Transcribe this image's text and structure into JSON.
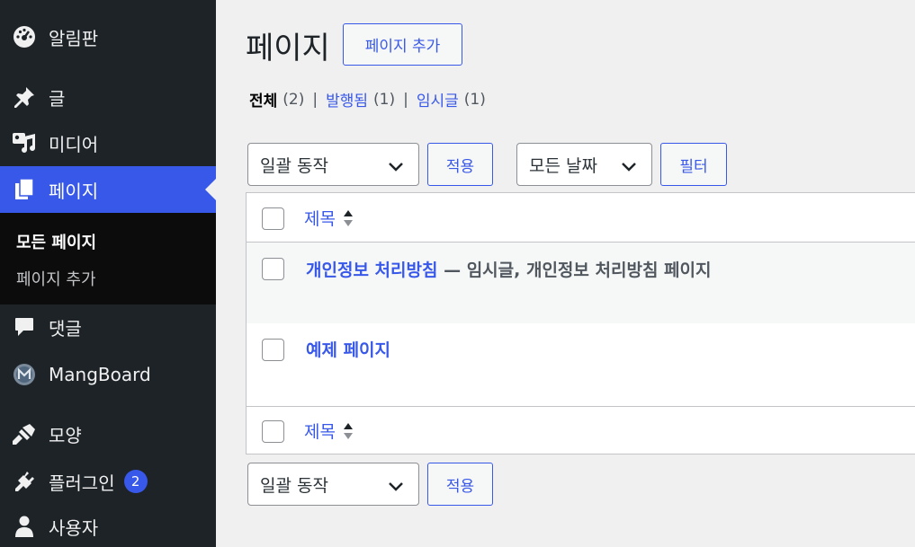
{
  "sidebar": {
    "items": [
      {
        "label": "알림판",
        "icon": "dashboard-icon"
      },
      {
        "label": "글",
        "icon": "pin-icon"
      },
      {
        "label": "미디어",
        "icon": "media-icon"
      },
      {
        "label": "페이지",
        "icon": "pages-icon"
      },
      {
        "label": "댓글",
        "icon": "comments-icon"
      },
      {
        "label": "MangBoard",
        "icon": "mangboard-icon"
      },
      {
        "label": "모양",
        "icon": "appearance-icon"
      },
      {
        "label": "플러그인",
        "icon": "plugins-icon",
        "badge": "2"
      },
      {
        "label": "사용자",
        "icon": "users-icon"
      }
    ],
    "submenu": [
      "모든 페이지",
      "페이지 추가"
    ]
  },
  "header": {
    "title": "페이지",
    "add_new": "페이지 추가"
  },
  "filters": {
    "all_label": "전체",
    "all_count": "(2)",
    "published_label": "발행됨",
    "published_count": "(1)",
    "draft_label": "임시글",
    "draft_count": "(1)",
    "separator": "|"
  },
  "toolbar": {
    "bulk_action": "일괄 동작",
    "apply": "적용",
    "date_filter": "모든 날짜",
    "filter": "필터"
  },
  "table": {
    "column_title": "제목",
    "rows": [
      {
        "title": "개인정보 처리방침",
        "state": " — 임시글, 개인정보 처리방침 페이지"
      },
      {
        "title": "예제 페이지",
        "state": ""
      }
    ]
  },
  "colors": {
    "accent": "#3858e9",
    "sidebar_bg": "#1d2327",
    "page_bg": "#f0f0f1"
  }
}
